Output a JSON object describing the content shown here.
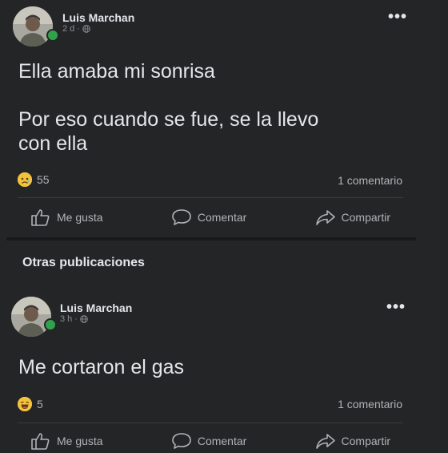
{
  "posts": [
    {
      "author": "Luis Marchan",
      "time": "2 d",
      "text": "Ella amaba mi sonrisa\n\nPor eso cuando se fue, se la llevo\ncon ella",
      "reaction_count": "55",
      "reaction_emoji": "sad-face-icon",
      "comments": "1 comentario"
    },
    {
      "author": "Luis Marchan",
      "time": "3 h",
      "text": "Me cortaron el gas",
      "reaction_count": "5",
      "reaction_emoji": "laughing-face-icon",
      "comments": "1 comentario"
    }
  ],
  "actions": {
    "like": "Me gusta",
    "comment": "Comentar",
    "share": "Compartir"
  },
  "section_title": "Otras publicaciones",
  "more_glyph": "•••",
  "colors": {
    "background": "#242526",
    "online": "#31a24c",
    "text": "#e4e6eb",
    "muted": "#b0b3b8"
  }
}
